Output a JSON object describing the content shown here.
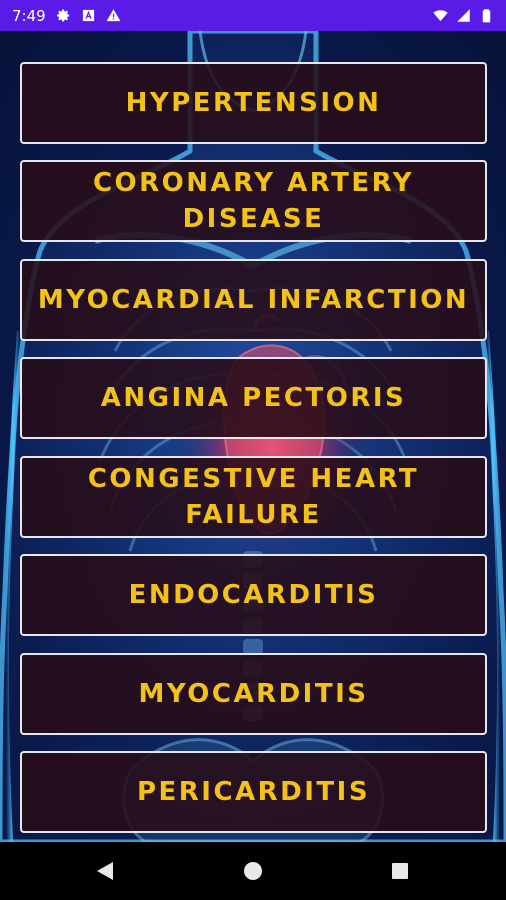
{
  "status_bar": {
    "time": "7:49",
    "icons": [
      "gear-icon",
      "app-badge-icon",
      "warning-icon",
      "wifi-icon",
      "signal-icon",
      "battery-icon"
    ]
  },
  "items": [
    {
      "label": "HYPERTENSION"
    },
    {
      "label": "CORONARY ARTERY DISEASE"
    },
    {
      "label": "MYOCARDIAL INFARCTION"
    },
    {
      "label": "ANGINA PECTORIS"
    },
    {
      "label": "CONGESTIVE HEART FAILURE"
    },
    {
      "label": "ENDOCARDITIS"
    },
    {
      "label": "MYOCARDITIS"
    },
    {
      "label": "PERICARDITIS"
    }
  ],
  "nav": {
    "buttons": [
      "back-icon",
      "home-icon",
      "recents-icon"
    ]
  },
  "colors": {
    "status_bar": "#5a1be6",
    "button_text": "#f2c218",
    "button_border": "#e6e6ee",
    "button_fill": "#280c18"
  }
}
